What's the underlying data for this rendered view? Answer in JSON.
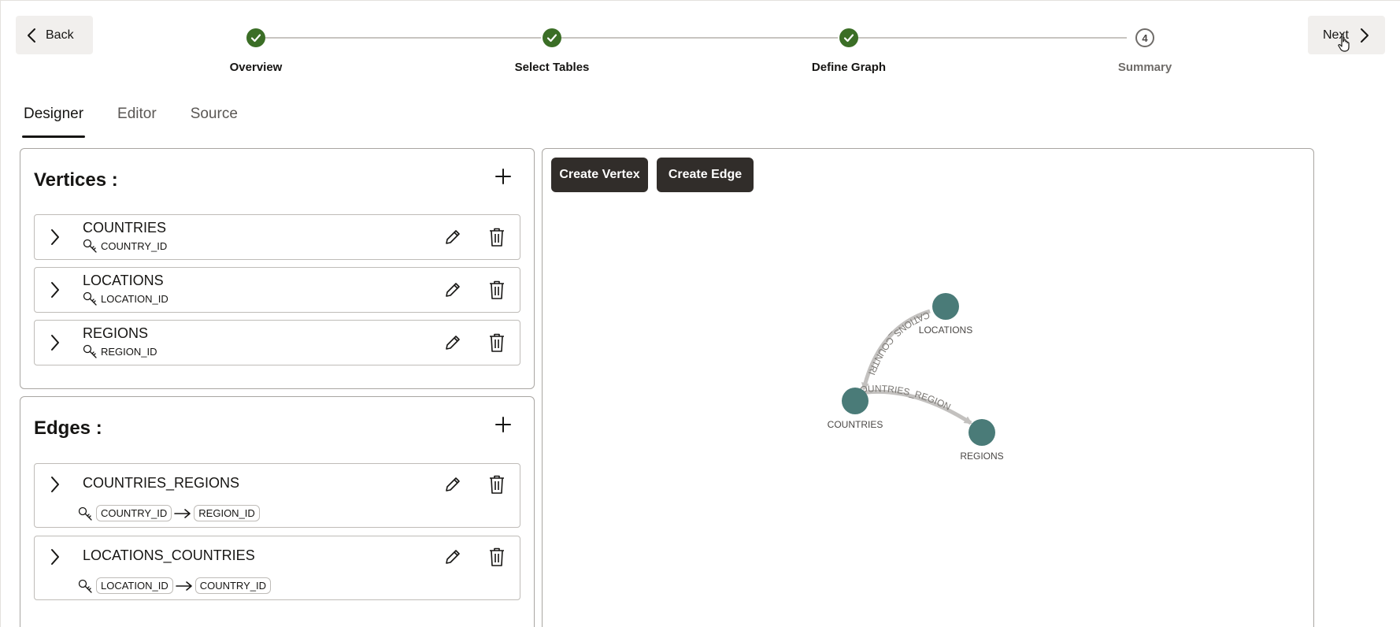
{
  "nav": {
    "back_label": "Back",
    "next_label": "Next"
  },
  "stepper": {
    "steps": [
      {
        "label": "Overview",
        "status": "complete"
      },
      {
        "label": "Select Tables",
        "status": "complete"
      },
      {
        "label": "Define Graph",
        "status": "complete"
      },
      {
        "label": "Summary",
        "status": "pending",
        "number": "4"
      }
    ]
  },
  "tabs": [
    {
      "label": "Designer",
      "active": true
    },
    {
      "label": "Editor",
      "active": false
    },
    {
      "label": "Source",
      "active": false
    }
  ],
  "vertices": {
    "title": "Vertices :",
    "items": [
      {
        "name": "COUNTRIES",
        "key": "COUNTRY_ID"
      },
      {
        "name": "LOCATIONS",
        "key": "LOCATION_ID"
      },
      {
        "name": "REGIONS",
        "key": "REGION_ID"
      }
    ]
  },
  "edges": {
    "title": "Edges :",
    "items": [
      {
        "name": "COUNTRIES_REGIONS",
        "source_key": "COUNTRY_ID",
        "target_key": "REGION_ID"
      },
      {
        "name": "LOCATIONS_COUNTRIES",
        "source_key": "LOCATION_ID",
        "target_key": "COUNTRY_ID"
      }
    ]
  },
  "canvas": {
    "create_vertex_label": "Create Vertex",
    "create_edge_label": "Create Edge",
    "graph": {
      "nodes": [
        {
          "id": "LOCATIONS",
          "label": "LOCATIONS"
        },
        {
          "id": "COUNTRIES",
          "label": "COUNTRIES"
        },
        {
          "id": "REGIONS",
          "label": "REGIONS"
        }
      ],
      "edges": [
        {
          "from": "LOCATIONS",
          "to": "COUNTRIES",
          "label": "CATIONS_COUNTRI"
        },
        {
          "from": "COUNTRIES",
          "to": "REGIONS",
          "label": "OUNTRIES_REGION"
        }
      ]
    }
  },
  "colors": {
    "step_complete": "#3b6e26",
    "node_fill": "#4a7b78",
    "dark_button": "#312d2a",
    "edge_stroke": "#c3c1bf"
  }
}
